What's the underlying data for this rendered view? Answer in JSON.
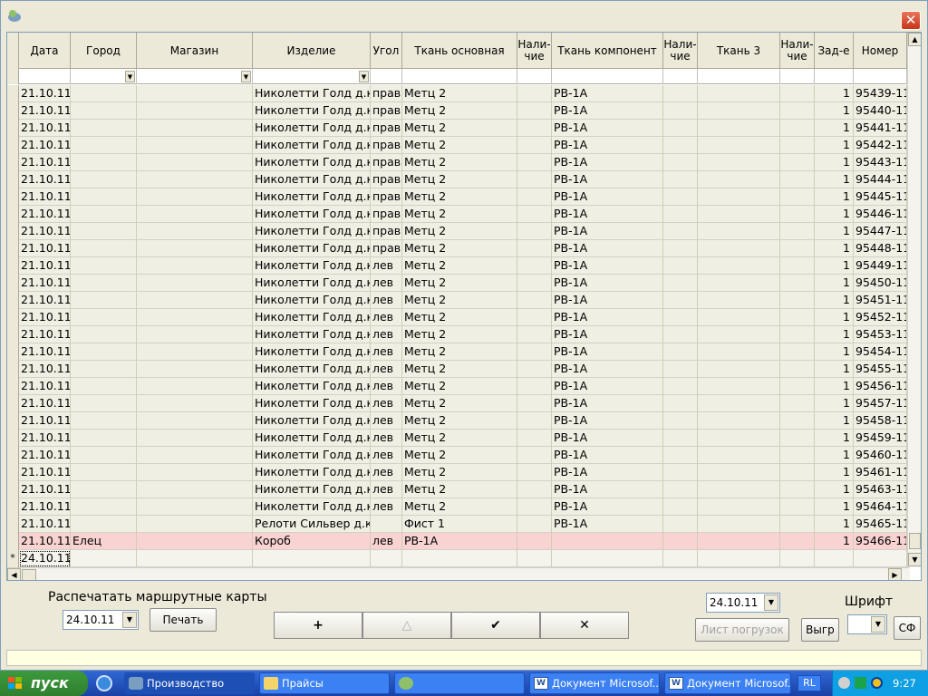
{
  "window": {
    "close_label": "✕"
  },
  "grid": {
    "headers": [
      "Дата",
      "Город",
      "Магазин",
      "Изделие",
      "Угол",
      "Ткань основная",
      "Нали-\nчие",
      "Ткань компонент",
      "Нали-\nчие",
      "Ткань 3",
      "Нали-\nчие",
      "Зад-е",
      "Номер"
    ],
    "rows": [
      [
        "21.10.11",
        "",
        "",
        "Николетти Голд д.к. у",
        "прав",
        "Метц 2",
        "",
        "РВ-1А",
        "",
        "",
        "",
        "1",
        "95439-11"
      ],
      [
        "21.10.11",
        "",
        "",
        "Николетти Голд д.к. у",
        "прав",
        "Метц 2",
        "",
        "РВ-1А",
        "",
        "",
        "",
        "1",
        "95440-11"
      ],
      [
        "21.10.11",
        "",
        "",
        "Николетти Голд д.к. у",
        "прав",
        "Метц 2",
        "",
        "РВ-1А",
        "",
        "",
        "",
        "1",
        "95441-11"
      ],
      [
        "21.10.11",
        "",
        "",
        "Николетти Голд д.к. у",
        "прав",
        "Метц 2",
        "",
        "РВ-1А",
        "",
        "",
        "",
        "1",
        "95442-11"
      ],
      [
        "21.10.11",
        "",
        "",
        "Николетти Голд д.к. у",
        "прав",
        "Метц 2",
        "",
        "РВ-1А",
        "",
        "",
        "",
        "1",
        "95443-11"
      ],
      [
        "21.10.11",
        "",
        "",
        "Николетти Голд д.к. у",
        "прав",
        "Метц 2",
        "",
        "РВ-1А",
        "",
        "",
        "",
        "1",
        "95444-11"
      ],
      [
        "21.10.11",
        "",
        "",
        "Николетти Голд д.к. у",
        "прав",
        "Метц 2",
        "",
        "РВ-1А",
        "",
        "",
        "",
        "1",
        "95445-11"
      ],
      [
        "21.10.11",
        "",
        "",
        "Николетти Голд д.к. у",
        "прав",
        "Метц 2",
        "",
        "РВ-1А",
        "",
        "",
        "",
        "1",
        "95446-11"
      ],
      [
        "21.10.11",
        "",
        "",
        "Николетти Голд д.к. у",
        "прав",
        "Метц 2",
        "",
        "РВ-1А",
        "",
        "",
        "",
        "1",
        "95447-11"
      ],
      [
        "21.10.11",
        "",
        "",
        "Николетти Голд д.к. у",
        "прав",
        "Метц 2",
        "",
        "РВ-1А",
        "",
        "",
        "",
        "1",
        "95448-11"
      ],
      [
        "21.10.11",
        "",
        "",
        "Николетти Голд д.к. у",
        "лев",
        "Метц 2",
        "",
        "РВ-1А",
        "",
        "",
        "",
        "1",
        "95449-11"
      ],
      [
        "21.10.11",
        "",
        "",
        "Николетти Голд д.к. у",
        "лев",
        "Метц 2",
        "",
        "РВ-1А",
        "",
        "",
        "",
        "1",
        "95450-11"
      ],
      [
        "21.10.11",
        "",
        "",
        "Николетти Голд д.к. у",
        "лев",
        "Метц 2",
        "",
        "РВ-1А",
        "",
        "",
        "",
        "1",
        "95451-11"
      ],
      [
        "21.10.11",
        "",
        "",
        "Николетти Голд д.к. у",
        "лев",
        "Метц 2",
        "",
        "РВ-1А",
        "",
        "",
        "",
        "1",
        "95452-11"
      ],
      [
        "21.10.11",
        "",
        "",
        "Николетти Голд д.к. у",
        "лев",
        "Метц 2",
        "",
        "РВ-1А",
        "",
        "",
        "",
        "1",
        "95453-11"
      ],
      [
        "21.10.11",
        "",
        "",
        "Николетти Голд д.к. у",
        "лев",
        "Метц 2",
        "",
        "РВ-1А",
        "",
        "",
        "",
        "1",
        "95454-11"
      ],
      [
        "21.10.11",
        "",
        "",
        "Николетти Голд д.к. у",
        "лев",
        "Метц 2",
        "",
        "РВ-1А",
        "",
        "",
        "",
        "1",
        "95455-11"
      ],
      [
        "21.10.11",
        "",
        "",
        "Николетти Голд д.к. у",
        "лев",
        "Метц 2",
        "",
        "РВ-1А",
        "",
        "",
        "",
        "1",
        "95456-11"
      ],
      [
        "21.10.11",
        "",
        "",
        "Николетти Голд д.к. у",
        "лев",
        "Метц 2",
        "",
        "РВ-1А",
        "",
        "",
        "",
        "1",
        "95457-11"
      ],
      [
        "21.10.11",
        "",
        "",
        "Николетти Голд д.к. у",
        "лев",
        "Метц 2",
        "",
        "РВ-1А",
        "",
        "",
        "",
        "1",
        "95458-11"
      ],
      [
        "21.10.11",
        "",
        "",
        "Николетти Голд д.к. у",
        "лев",
        "Метц 2",
        "",
        "РВ-1А",
        "",
        "",
        "",
        "1",
        "95459-11"
      ],
      [
        "21.10.11",
        "",
        "",
        "Николетти Голд д.к. у",
        "лев",
        "Метц 2",
        "",
        "РВ-1А",
        "",
        "",
        "",
        "1",
        "95460-11"
      ],
      [
        "21.10.11",
        "",
        "",
        "Николетти Голд д.к. у",
        "лев",
        "Метц 2",
        "",
        "РВ-1А",
        "",
        "",
        "",
        "1",
        "95461-11"
      ],
      [
        "21.10.11",
        "",
        "",
        "Николетти Голд д.к. у",
        "лев",
        "Метц 2",
        "",
        "РВ-1А",
        "",
        "",
        "",
        "1",
        "95463-11"
      ],
      [
        "21.10.11",
        "",
        "",
        "Николетти Голд д.к. у",
        "лев",
        "Метц 2",
        "",
        "РВ-1А",
        "",
        "",
        "",
        "1",
        "95464-11"
      ],
      [
        "21.10.11",
        "",
        "",
        "Релоти Сильвер д.к.",
        "",
        "Фист 1",
        "",
        "РВ-1А",
        "",
        "",
        "",
        "1",
        "95465-11"
      ],
      [
        "21.10.11",
        "Елец",
        "",
        "Короб",
        "лев",
        "РВ-1А",
        "",
        "",
        "",
        "",
        "",
        "1",
        "95466-11"
      ]
    ],
    "new_row": {
      "marker": "*",
      "date": "24.10.11"
    }
  },
  "bottom": {
    "print_routes_label": "Распечатать маршрутные карты",
    "print_date": "24.10.11",
    "print_button": "Печать",
    "nav_add": "+",
    "nav_up": "△",
    "nav_ok": "✔",
    "nav_cancel": "✕",
    "load_date": "24.10.11",
    "load_sheet_button": "Лист погрузок",
    "export_button": "Выгр",
    "font_label": "Шрифт",
    "font_value": "",
    "sf_button": "СФ"
  },
  "taskbar": {
    "start_label": "пуск",
    "items": [
      "Производство",
      "Прайсы",
      "",
      "Документ Microsof...",
      "Документ Microsof..."
    ],
    "lang": "RL",
    "clock": "9:27"
  },
  "colors": {
    "highlight_row": "#f9d2d2",
    "taskbar": "#245edb",
    "start": "#3c9a3c"
  }
}
